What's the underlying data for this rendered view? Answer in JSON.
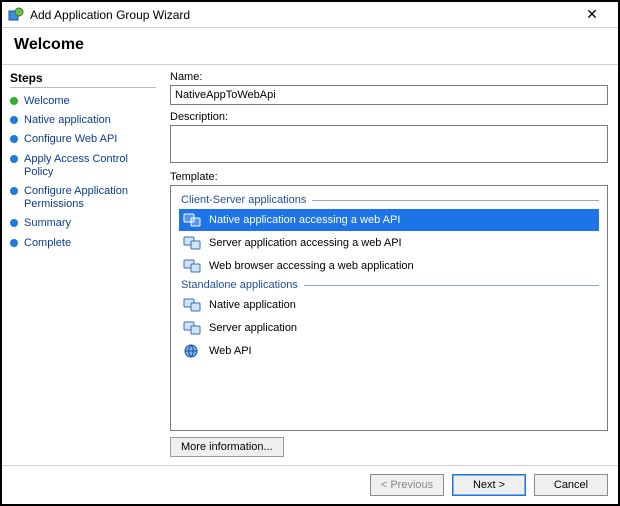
{
  "window": {
    "title": "Add Application Group Wizard",
    "close_glyph": "✕"
  },
  "header": {
    "title": "Welcome"
  },
  "steps": {
    "title": "Steps",
    "items": [
      {
        "label": "Welcome",
        "current": true
      },
      {
        "label": "Native application",
        "current": false
      },
      {
        "label": "Configure Web API",
        "current": false
      },
      {
        "label": "Apply Access Control Policy",
        "current": false
      },
      {
        "label": "Configure Application Permissions",
        "current": false
      },
      {
        "label": "Summary",
        "current": false
      },
      {
        "label": "Complete",
        "current": false
      }
    ]
  },
  "form": {
    "name_label": "Name:",
    "name_value": "NativeAppToWebApi",
    "description_label": "Description:",
    "description_value": "",
    "template_label": "Template:",
    "more_info_label": "More information..."
  },
  "templates": {
    "groups": [
      {
        "title": "Client-Server applications",
        "items": [
          {
            "id": "native-to-webapi",
            "label": "Native application accessing a web API",
            "selected": true,
            "icon": "native-webapi-icon"
          },
          {
            "id": "server-to-webapi",
            "label": "Server application accessing a web API",
            "selected": false,
            "icon": "server-webapi-icon"
          },
          {
            "id": "browser-webapp",
            "label": "Web browser accessing a web application",
            "selected": false,
            "icon": "browser-webapp-icon"
          }
        ]
      },
      {
        "title": "Standalone applications",
        "items": [
          {
            "id": "native-app",
            "label": "Native application",
            "selected": false,
            "icon": "native-app-icon"
          },
          {
            "id": "server-app",
            "label": "Server application",
            "selected": false,
            "icon": "server-app-icon"
          },
          {
            "id": "web-api",
            "label": "Web API",
            "selected": false,
            "icon": "web-api-icon"
          }
        ]
      }
    ]
  },
  "footer": {
    "previous": "< Previous",
    "next": "Next >",
    "cancel": "Cancel"
  }
}
